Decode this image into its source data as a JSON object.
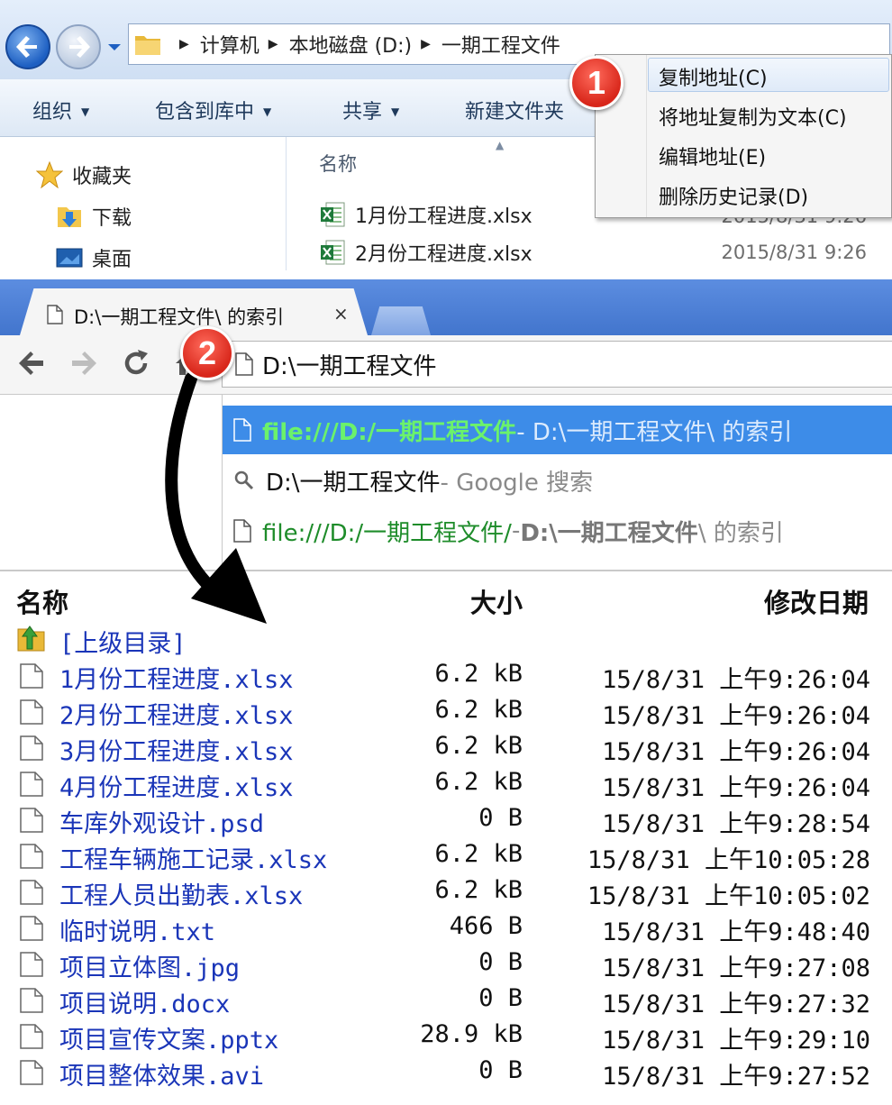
{
  "explorer": {
    "breadcrumbs": [
      "计算机",
      "本地磁盘 (D:)",
      "一期工程文件"
    ],
    "toolbar": [
      {
        "label": "组织",
        "has_caret": true
      },
      {
        "label": "包含到库中",
        "has_caret": true
      },
      {
        "label": "共享",
        "has_caret": true
      },
      {
        "label": "新建文件夹",
        "has_caret": false
      }
    ],
    "sidebar": {
      "favorites": "收藏夹",
      "downloads": "下载",
      "desktop": "桌面"
    },
    "column_name": "名称",
    "files": [
      {
        "name": "1月份工程进度.xlsx",
        "date": "2015/8/31 9:26"
      },
      {
        "name": "2月份工程进度.xlsx",
        "date": "2015/8/31 9:26"
      }
    ],
    "context_menu": [
      "复制地址(C)",
      "将地址复制为文本(C)",
      "编辑地址(E)",
      "删除历史记录(D)"
    ]
  },
  "badges": [
    "1",
    "2"
  ],
  "chrome": {
    "tab_title": "D:\\一期工程文件\\ 的索引",
    "tab_close": "×",
    "omnibox_text": "D:\\一期工程文件",
    "suggestions": [
      {
        "url": "file:///D:/一期工程文件",
        "desc": " - D:\\一期工程文件\\ 的索引"
      },
      {
        "query": "D:\\一期工程文件",
        "desc": " - Google 搜索"
      },
      {
        "url": "file:///D:/一期工程文件/",
        "sep": " - ",
        "bold": "D:\\一期工程文件",
        "rest": "\\ 的索引"
      }
    ]
  },
  "listing": {
    "headers": {
      "name": "名称",
      "size": "大小",
      "date": "修改日期"
    },
    "parent": "[上级目录]",
    "rows": [
      {
        "name": "1月份工程进度.xlsx",
        "size": "6.2 kB",
        "date": "15/8/31 上午9:26:04"
      },
      {
        "name": "2月份工程进度.xlsx",
        "size": "6.2 kB",
        "date": "15/8/31 上午9:26:04"
      },
      {
        "name": "3月份工程进度.xlsx",
        "size": "6.2 kB",
        "date": "15/8/31 上午9:26:04"
      },
      {
        "name": "4月份工程进度.xlsx",
        "size": "6.2 kB",
        "date": "15/8/31 上午9:26:04"
      },
      {
        "name": "车库外观设计.psd",
        "size": "0 B",
        "date": "15/8/31 上午9:28:54"
      },
      {
        "name": "工程车辆施工记录.xlsx",
        "size": "6.2 kB",
        "date": "15/8/31 上午10:05:28"
      },
      {
        "name": "工程人员出勤表.xlsx",
        "size": "6.2 kB",
        "date": "15/8/31 上午10:05:02"
      },
      {
        "name": "临时说明.txt",
        "size": "466 B",
        "date": "15/8/31 上午9:48:40"
      },
      {
        "name": "项目立体图.jpg",
        "size": "0 B",
        "date": "15/8/31 上午9:27:08"
      },
      {
        "name": "项目说明.docx",
        "size": "0 B",
        "date": "15/8/31 上午9:27:32"
      },
      {
        "name": "项目宣传文案.pptx",
        "size": "28.9 kB",
        "date": "15/8/31 上午9:29:10"
      },
      {
        "name": "项目整体效果.avi",
        "size": "0 B",
        "date": "15/8/31 上午9:27:52"
      }
    ]
  },
  "icons": {
    "back": "back-arrow-icon",
    "forward": "forward-arrow-icon",
    "folder": "folder-icon",
    "star": "star-icon",
    "excel": "excel-file-icon",
    "file": "file-icon",
    "reload": "reload-icon",
    "home": "home-icon",
    "search": "search-icon",
    "parent": "parent-folder-icon"
  },
  "colors": {
    "link": "#1a35b8",
    "highlight": "#3d8ce8",
    "url_green": "#1e8c2a",
    "badge": "#d8261a",
    "tabstrip": "#4275cd"
  }
}
